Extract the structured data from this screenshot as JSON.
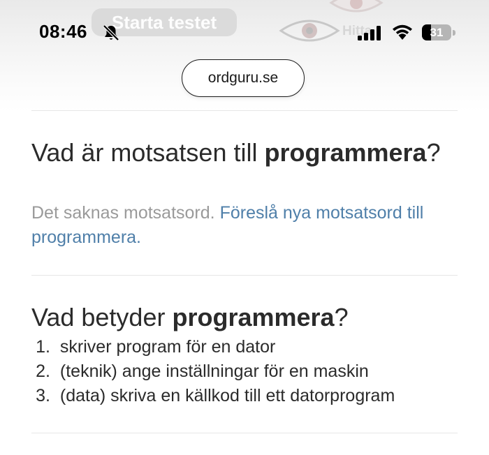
{
  "background_ad": {
    "button_label": "Starta testet",
    "word": "Hitta"
  },
  "status_bar": {
    "time": "08:46",
    "battery_level": "31",
    "battery_fraction": 0.31
  },
  "browser": {
    "url": "ordguru.se"
  },
  "antonym_section": {
    "question_prefix": "Vad är motsatsen till ",
    "word": "programmera",
    "question_suffix": "?",
    "note_text": "Det saknas motsatsord. ",
    "suggest_link": "Föreslå nya motsatsord till programmera."
  },
  "meaning_section": {
    "question_prefix": "Vad betyder ",
    "word": "programmera",
    "question_suffix": "?",
    "definitions": [
      {
        "num": "1.",
        "text": "skriver program  för en dator"
      },
      {
        "num": "2.",
        "text": "(teknik) ange inställningar för en maskin"
      },
      {
        "num": "3.",
        "text": "(data) skriva en källkod till ett datorprogram"
      }
    ]
  },
  "colors": {
    "link": "#4f7fa9",
    "muted_text": "#9a9a9a",
    "body_text": "#2b2b2b"
  }
}
